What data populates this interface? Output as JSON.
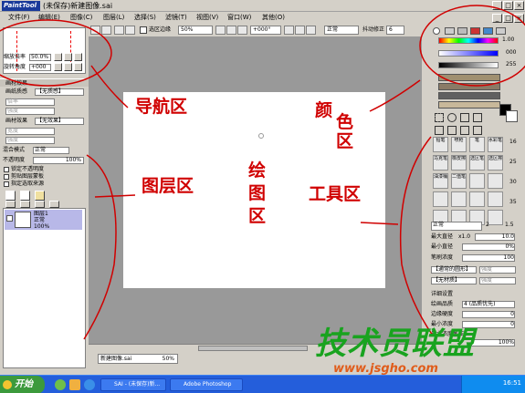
{
  "titlebar": {
    "logo": "PaintTool SAI",
    "title": "(未保存)新建图像.sai"
  },
  "menu": [
    "文件(F)",
    "编辑(E)",
    "图像(C)",
    "图层(L)",
    "选择(S)",
    "滤镜(T)",
    "视图(V)",
    "窗口(W)",
    "其他(O)"
  ],
  "toolbar": {
    "selection_edge": "选区边缘",
    "zoom": "50%",
    "rotation": "+000°",
    "mode": "正常",
    "stabilizer_label": "抖动修正",
    "stabilizer": "6"
  },
  "nav": {
    "zoom_label": "缩放倍率",
    "zoom_value": "50.0%",
    "rotate_label": "旋转角度",
    "rotate_value": "+000"
  },
  "layer": {
    "paper_texture_section": "画材效果",
    "paper_texture_label": "画纸质感",
    "paper_texture_value": "【无质感】",
    "scale_label": "倍率",
    "strength_label": "强度",
    "effect_label": "画材效果",
    "effect_value": "【无效果】",
    "width_label": "宽度",
    "blend_label": "混合模式",
    "blend_value": "正常",
    "opacity_label": "不透明度",
    "opacity_value": "100%",
    "checks": [
      "锁定不透明度",
      "剪贴图层蒙板",
      "指定选取来源"
    ],
    "layer_name": "图层1",
    "layer_mode": "正常",
    "layer_opacity": "100%"
  },
  "canvas": {
    "doc_tab": "新建图像.sai",
    "doc_zoom": "50%"
  },
  "color": {
    "hsv_value": "1.00",
    "s_value": "000",
    "v_value": "255"
  },
  "brush": {
    "tools": [
      "铅笔",
      "喷枪",
      "笔",
      "水彩笔",
      "马克笔",
      "橡皮擦",
      "选区笔",
      "选区擦",
      "油漆桶",
      "二值笔",
      "",
      "",
      "",
      "",
      "",
      "",
      "",
      "",
      "",
      ""
    ],
    "mode": "正常",
    "max_diam_label": "最大直径",
    "max_diam_mult": "x1.0",
    "max_diam_value": "10.0",
    "min_diam_label": "最小直径",
    "min_diam_value": "0%",
    "density_label": "笔刷浓度",
    "density_value": "100",
    "shape_value": "【通常的圆形】",
    "shape_strength": "强度",
    "texture_value": "【无材质】",
    "texture_strength": "强度",
    "detail_label": "详细设置",
    "quality_label": "绘画品质",
    "quality_value": "4 (品质优先)",
    "edge_label": "边缘硬度",
    "edge_value": "0",
    "min_density_label": "最小浓度",
    "min_density_value": "0",
    "max_pressure_label": "最大浓度笔压",
    "max_pressure_value": "100%",
    "sizes": [
      "1.5",
      "2",
      "2.3",
      "2.6",
      "3",
      "3.5",
      "4",
      "5",
      "6",
      "7",
      "8",
      "9",
      "10",
      "12",
      "14",
      "16",
      "20",
      "25",
      "30",
      "35"
    ]
  },
  "annotations": {
    "nav": "导航区",
    "color": [
      "颜",
      "色",
      "区"
    ],
    "layer": "图层区",
    "draw": [
      "绘",
      "图",
      "区"
    ],
    "tool": "工具区"
  },
  "taskbar": {
    "start": "开始",
    "items": [
      "SAI - (未保存)新...",
      "Adobe Photoshop"
    ],
    "clock": "16:51"
  },
  "watermark": {
    "main": "技术员联盟",
    "url": "www.jsgho.com"
  },
  "colors": {
    "annotation": "#d00000",
    "watermark_green": "#19a31f",
    "watermark_orange": "#e05c1a",
    "taskbar": "#245edb"
  }
}
